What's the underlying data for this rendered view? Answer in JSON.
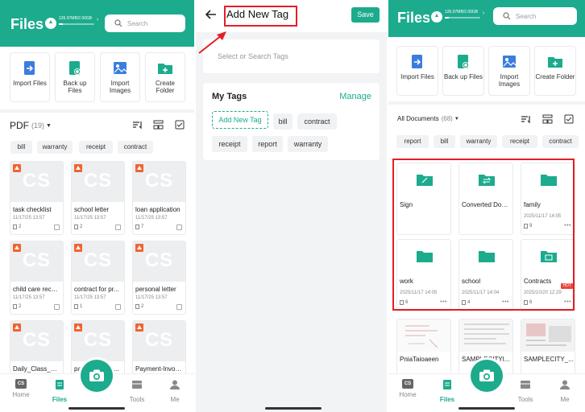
{
  "colors": {
    "brand": "#1cab8d",
    "annotation": "#e41e26",
    "pdf_badge": "#f0642f"
  },
  "left": {
    "title": "Files",
    "storage_text": "126.97MB/2.00GB",
    "search_placeholder": "Search",
    "quick_actions": [
      {
        "label": "Import Files",
        "icon": "import-files-icon"
      },
      {
        "label": "Back up Files",
        "icon": "backup-files-icon"
      },
      {
        "label": "Import Images",
        "icon": "import-images-icon"
      },
      {
        "label": "Create Folder",
        "icon": "create-folder-icon"
      }
    ],
    "filter_label": "PDF",
    "filter_count": "(19)",
    "tags": [
      "bill",
      "warranty",
      "receipt",
      "contract"
    ],
    "docs": [
      {
        "name": "task checklist",
        "date": "11/17/25 13:57",
        "pages": "2"
      },
      {
        "name": "school letter",
        "date": "11/17/25 13:57",
        "pages": "2"
      },
      {
        "name": "loan application",
        "date": "11/17/25 13:57",
        "pages": "7"
      },
      {
        "name": "child care receipt",
        "date": "11/17/25 13:57",
        "pages": "2"
      },
      {
        "name": "contract for pr...",
        "date": "11/17/25 13:57",
        "pages": "1"
      },
      {
        "name": "personal letter",
        "date": "11/17/25 13:57",
        "pages": "2"
      },
      {
        "name": "Daily_Class_Sc...",
        "date": "",
        "pages": ""
      },
      {
        "name": "payme...nvoic...",
        "date": "",
        "pages": ""
      },
      {
        "name": "Payment-Invoice",
        "date": "",
        "pages": ""
      }
    ],
    "tabs": [
      "Home",
      "Files",
      "Tools",
      "Me"
    ],
    "thumb_text": "CS",
    "tab_home_icon_text": "CS"
  },
  "middle": {
    "title": "Add New Tag",
    "save_label": "Save",
    "search_placeholder": "Select or Search Tags",
    "my_tags_heading": "My Tags",
    "manage_label": "Manage",
    "add_new_tag_chip": "Add New Tag",
    "tags": [
      "bill",
      "contract",
      "receipt",
      "report",
      "warranty"
    ]
  },
  "right": {
    "title": "Files",
    "storage_text": "126.97MB/2.00GB",
    "search_placeholder": "Search",
    "quick_actions": [
      {
        "label": "Import Files",
        "icon": "import-files-icon"
      },
      {
        "label": "Back up Files",
        "icon": "backup-files-icon"
      },
      {
        "label": "Import Images",
        "icon": "import-images-icon"
      },
      {
        "label": "Create Folder",
        "icon": "create-folder-icon"
      }
    ],
    "filter_label": "All Documents",
    "filter_count": "(68)",
    "tags": [
      "report",
      "bill",
      "warranty",
      "receipt",
      "contract"
    ],
    "folders": [
      {
        "name": "Sign",
        "date": "",
        "count": ""
      },
      {
        "name": "Converted Doc...",
        "date": "",
        "count": ""
      },
      {
        "name": "family",
        "date": "2025/11/17 14:05",
        "count": "9"
      },
      {
        "name": "work",
        "date": "2025/11/17 14:05",
        "count": "6"
      },
      {
        "name": "school",
        "date": "2025/11/17 14:04",
        "count": "4"
      },
      {
        "name": "Contracts",
        "date": "2025/10/20 12:29",
        "count": "6",
        "badge": "HOT"
      }
    ],
    "bottom_docs": [
      "PniaTaioaeen",
      "SAMPLECITYI...",
      "SAMPLECITY_..."
    ],
    "tabs": [
      "Home",
      "Files",
      "Tools",
      "Me"
    ],
    "tab_home_icon_text": "CS"
  }
}
